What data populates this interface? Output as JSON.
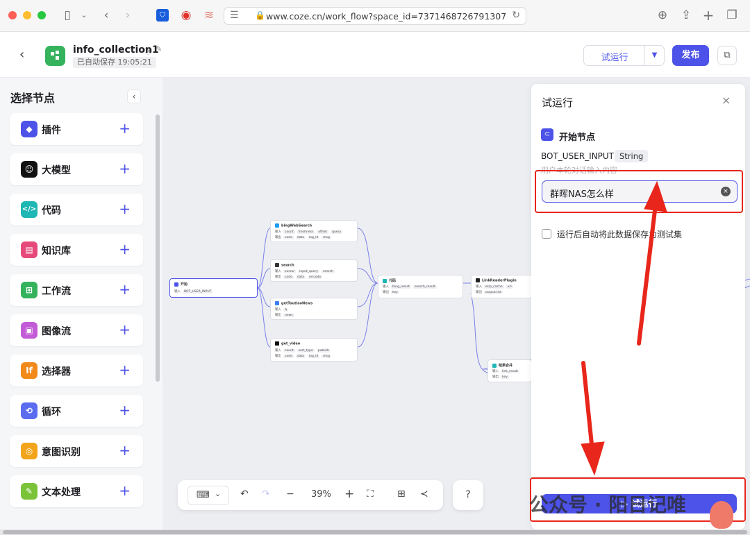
{
  "browser": {
    "url": "www.coze.cn/work_flow?space_id=7371468726791307304&w",
    "icons": [
      "sidebar-icon",
      "back-icon",
      "forward-icon",
      "bitwarden-icon",
      "record-icon",
      "rss-icon",
      "reader-icon",
      "lock-icon",
      "reload-icon",
      "download-icon",
      "share-icon",
      "new-tab-icon",
      "tabs-icon"
    ]
  },
  "header": {
    "title": "info_collection1",
    "status": "已自动保存 19:05:21",
    "run_label": "试运行",
    "publish_label": "发布"
  },
  "sidebar": {
    "title": "选择节点",
    "items": [
      {
        "label": "插件",
        "color": "#4d53e8",
        "glyph": "◆"
      },
      {
        "label": "大模型",
        "color": "#111111",
        "glyph": "☺"
      },
      {
        "label": "代码",
        "color": "#1fb7b4",
        "glyph": "</>"
      },
      {
        "label": "知识库",
        "color": "#e64a7b",
        "glyph": "▤"
      },
      {
        "label": "工作流",
        "color": "#35b25c",
        "glyph": "⊞"
      },
      {
        "label": "图像流",
        "color": "#c35ad6",
        "glyph": "▣"
      },
      {
        "label": "选择器",
        "color": "#f28a1a",
        "glyph": "If"
      },
      {
        "label": "循环",
        "color": "#5b6cf0",
        "glyph": "⟲"
      },
      {
        "label": "意图识别",
        "color": "#f2a51a",
        "glyph": "◎"
      },
      {
        "label": "文本处理",
        "color": "#7bc43a",
        "glyph": "✎"
      }
    ]
  },
  "canvas": {
    "nodes": [
      {
        "title": "开始",
        "rows": [
          {
            "label": "输入",
            "tags": [
              "BOT_USER_INPUT"
            ]
          }
        ]
      },
      {
        "title": "bingWebSearch",
        "rows": [
          {
            "label": "输入",
            "tags": [
              "count",
              "freshness",
              "offset",
              "query"
            ]
          },
          {
            "label": "输出",
            "tags": [
              "code",
              "data",
              "log_id",
              "msg"
            ]
          }
        ]
      },
      {
        "title": "search",
        "rows": [
          {
            "label": "输入",
            "tags": [
              "cursor",
              "input_query",
              "search"
            ]
          },
          {
            "label": "输出",
            "tags": [
              "code",
              "data",
              "errcode"
            ]
          }
        ]
      },
      {
        "title": "getToutiaoNews",
        "rows": [
          {
            "label": "输入",
            "tags": [
              "q"
            ]
          },
          {
            "label": "输出",
            "tags": [
              "news"
            ]
          }
        ]
      },
      {
        "title": "get_video",
        "rows": [
          {
            "label": "输入",
            "tags": [
              "count",
              "sort_type",
              "publish"
            ]
          },
          {
            "label": "输出",
            "tags": [
              "code",
              "data",
              "log_id",
              "msg"
            ]
          }
        ]
      },
      {
        "title": "代码",
        "rows": [
          {
            "label": "输入",
            "tags": [
              "bing_result",
              "search_result"
            ]
          },
          {
            "label": "输出",
            "tags": [
              "key"
            ]
          }
        ]
      },
      {
        "title": "LinkReaderPlugin",
        "rows": [
          {
            "label": "输入",
            "tags": [
              "skip_cache",
              "url"
            ]
          },
          {
            "label": "输出",
            "tags": [
              "output.list"
            ]
          }
        ]
      },
      {
        "title": "结果合并",
        "rows": [
          {
            "label": "输入",
            "tags": [
              "link_result"
            ]
          },
          {
            "label": "输出",
            "tags": [
              "key"
            ]
          }
        ]
      }
    ],
    "toolbar": {
      "zoom": "39%"
    }
  },
  "panel": {
    "title": "试运行",
    "start_node": "开始节点",
    "param_name": "BOT_USER_INPUT",
    "param_type": "String",
    "param_hint": "用户本轮对话输入内容",
    "input_value": "群晖NAS怎么样",
    "save_label": "运行后自动将此数据保存为测试集",
    "run_button": "试运行"
  },
  "watermark": "公众号 · 阳日记唯",
  "colors": {
    "accent": "#4d53e8",
    "annotation": "#e8261b"
  }
}
